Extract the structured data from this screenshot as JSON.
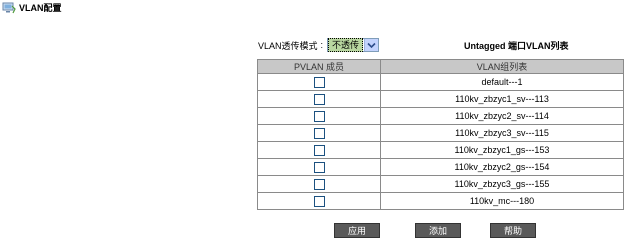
{
  "header": {
    "title": "VLAN配置",
    "icon": "monitor-icon"
  },
  "mode": {
    "label": "VLAN透传模式",
    "separator": ":",
    "selected": "不透传"
  },
  "untagged_title": "Untagged 端口VLAN列表",
  "table": {
    "headers": [
      "PVLAN 成员",
      "VLAN组列表"
    ],
    "rows": [
      {
        "checked": false,
        "vlan": "default---1"
      },
      {
        "checked": false,
        "vlan": "110kv_zbzyc1_sv---113"
      },
      {
        "checked": false,
        "vlan": "110kv_zbzyc2_sv---114"
      },
      {
        "checked": false,
        "vlan": "110kv_zbzyc3_sv---115"
      },
      {
        "checked": false,
        "vlan": "110kv_zbzyc1_gs---153"
      },
      {
        "checked": false,
        "vlan": "110kv_zbzyc2_gs---154"
      },
      {
        "checked": false,
        "vlan": "110kv_zbzyc3_gs---155"
      },
      {
        "checked": false,
        "vlan": "110kv_mc---180"
      }
    ]
  },
  "buttons": {
    "apply": "应用",
    "add": "添加",
    "help": "帮助"
  }
}
